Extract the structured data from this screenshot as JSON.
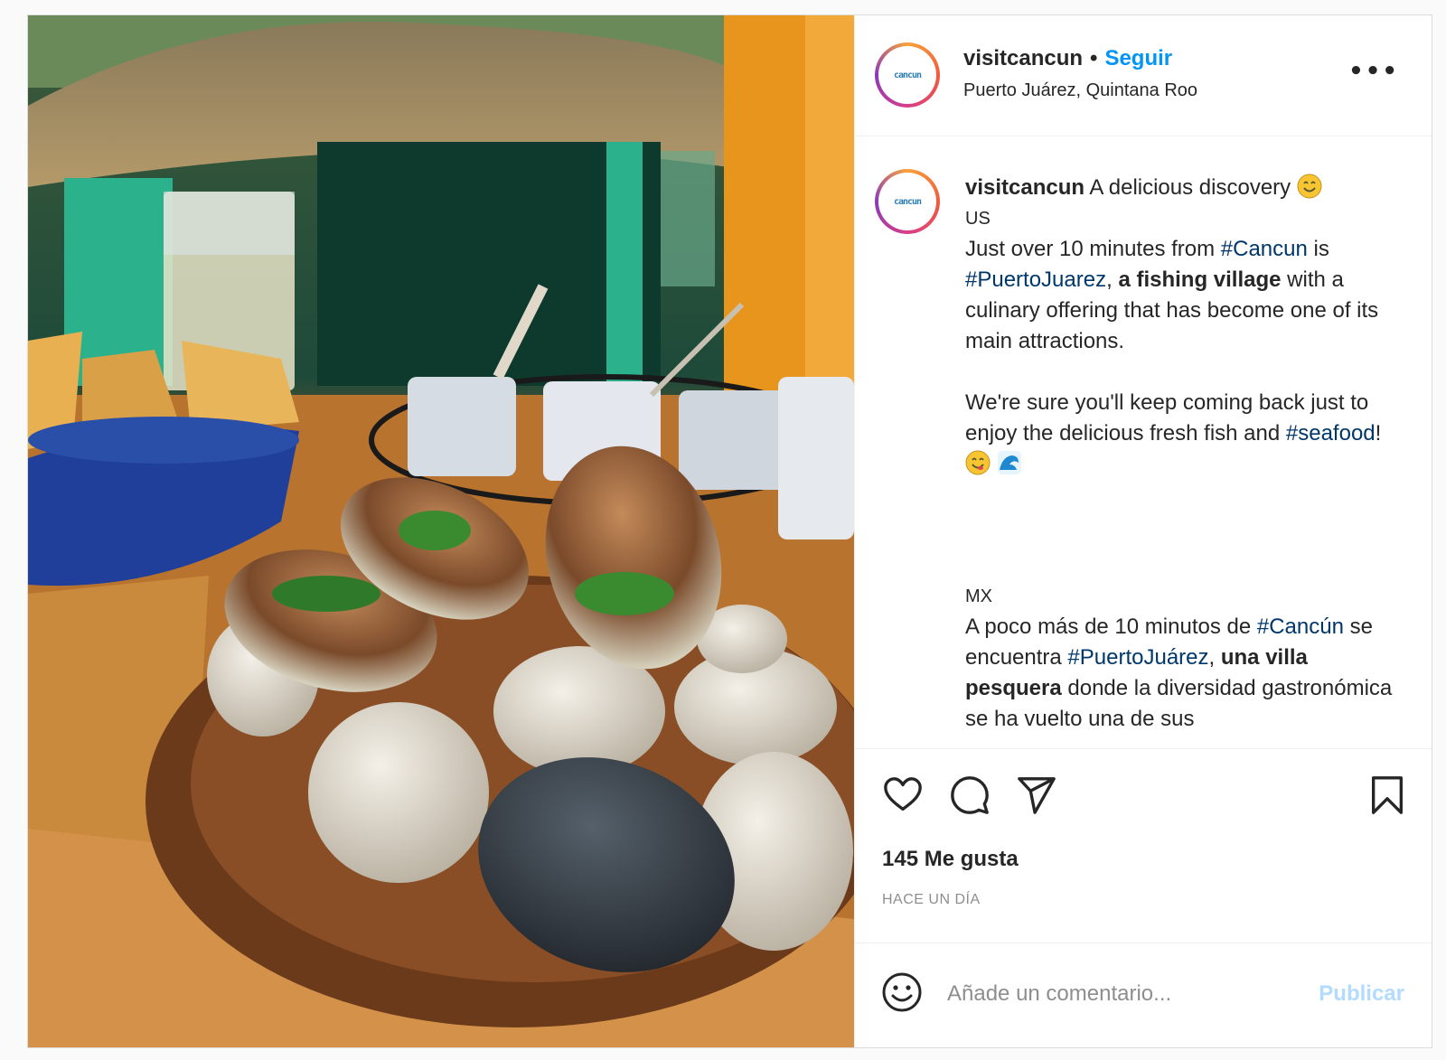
{
  "post": {
    "username": "visitcancun",
    "follow_label": "Seguir",
    "separator": "•",
    "location": "Puerto Juárez, Quintana Roo",
    "more_icon": "more-options-icon",
    "avatar_text": "cancun"
  },
  "caption": {
    "username": "visitcancun",
    "title": "A delicious discovery",
    "us_code": "US",
    "us_p1_a": "Just over 10 minutes from ",
    "us_p1_tag1": "#Cancun",
    "us_p1_b": " is ",
    "us_p1_tag2": "#PuertoJuarez",
    "us_p1_c": ", ",
    "us_p1_bold": "a fishing village",
    "us_p1_d": " with a culinary offering that has become one of its main attractions.",
    "us_p2": "We're sure you'll keep coming back just to enjoy the delicious fresh fish and ",
    "us_p2_tag": "#seafood",
    "us_p2_end": "!",
    "mx_code": "MX",
    "mx_p1_a": "A poco más de 10 minutos de ",
    "mx_p1_tag1": "#Cancún",
    "mx_p1_b": " se encuentra ",
    "mx_p1_tag2": "#PuertoJuárez",
    "mx_p1_c": ", ",
    "mx_p1_bold": "una villa pesquera",
    "mx_p1_d": " donde la diversidad gastronómica se ha vuelto una de sus"
  },
  "actions": {
    "icons": [
      "heart-icon",
      "comment-icon",
      "share-icon",
      "bookmark-icon"
    ],
    "likes": "145 Me gusta",
    "time_ago": "HACE UN DÍA"
  },
  "comment": {
    "placeholder": "Añade un comentario...",
    "publish_label": "Publicar",
    "emoji_icon": "smile-icon"
  },
  "colors": {
    "link": "#0095f6",
    "hashtag": "#00376b",
    "publish_disabled": "#b3dbff",
    "muted": "#8e8e8e"
  }
}
